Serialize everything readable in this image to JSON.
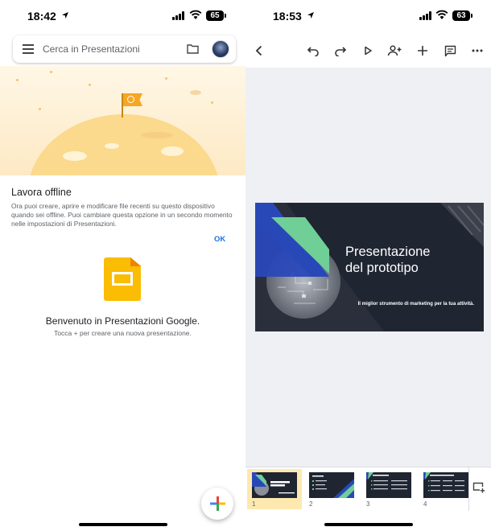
{
  "left": {
    "status": {
      "time": "18:42",
      "battery": "65"
    },
    "search": {
      "placeholder": "Cerca in Presentazioni"
    },
    "offline": {
      "title": "Lavora offline",
      "text": "Ora puoi creare, aprire e modificare file recenti su questo dispositivo quando sei offline. Puoi cambiare questa opzione in un secondo momento nelle impostazioni di Presentazioni.",
      "ok_label": "OK"
    },
    "welcome": "Benvenuto in Presentazioni Google.",
    "hint": "Tocca + per creare una nuova presentazione."
  },
  "right": {
    "status": {
      "time": "18:53",
      "battery": "63"
    },
    "slide": {
      "title_line1": "Presentazione",
      "title_line2": "del prototipo",
      "subtitle": "Il miglior strumento di marketing per la tua attività."
    },
    "thumbnails": [
      {
        "number": "1",
        "selected": true
      },
      {
        "number": "2",
        "selected": false
      },
      {
        "number": "3",
        "selected": false
      },
      {
        "number": "4",
        "selected": false
      }
    ]
  },
  "colors": {
    "accent_blue": "#1a73e8",
    "slides_yellow": "#fbbc04",
    "slide_bg": "#1f2531",
    "slide_green": "#6fcf97",
    "slide_blue": "#2948b8"
  }
}
